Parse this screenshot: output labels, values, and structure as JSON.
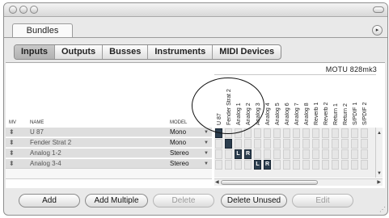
{
  "doc_tab": "Bundles",
  "corner_icon": "▸",
  "segments": [
    "Inputs",
    "Outputs",
    "Busses",
    "Instruments",
    "MIDI Devices"
  ],
  "device": "MOTU 828mk3",
  "list_columns": {
    "mv": "MV",
    "name": "NAME",
    "model": "MODEL"
  },
  "rows": [
    {
      "name": "U 87",
      "model": "Mono"
    },
    {
      "name": "Fender Strat 2",
      "model": "Mono"
    },
    {
      "name": "Analog 1-2",
      "model": "Stereo"
    },
    {
      "name": "Analog 3-4",
      "model": "Stereo"
    }
  ],
  "grid_columns": [
    "U 87",
    "Fender Strat 2",
    "Analog 1",
    "Analog 2",
    "Analog 3",
    "Analog 4",
    "Analog 5",
    "Analog 6",
    "Analog 7",
    "Analog 8",
    "Reverb 1",
    "Reverb 2",
    "Return 1",
    "Return 2",
    "S/PDIF 1",
    "S/PDIF 2"
  ],
  "grid_marks": [
    {
      "row": 0,
      "col": 0,
      "label": ""
    },
    {
      "row": 1,
      "col": 1,
      "label": ""
    },
    {
      "row": 2,
      "col": 2,
      "label": "L"
    },
    {
      "row": 2,
      "col": 3,
      "label": "R"
    },
    {
      "row": 3,
      "col": 4,
      "label": "L"
    },
    {
      "row": 3,
      "col": 5,
      "label": "R"
    }
  ],
  "buttons": {
    "add": "Add",
    "add_multiple": "Add Multiple",
    "delete": "Delete",
    "delete_unused": "Delete Unused",
    "edit": "Edit"
  },
  "colors": {
    "active_cell": "#2c3e4f"
  }
}
